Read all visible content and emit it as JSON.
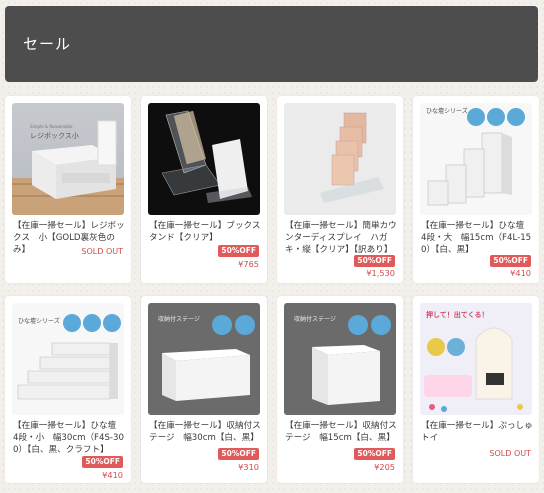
{
  "header": {
    "title": "セール"
  },
  "products": [
    {
      "name": "【在庫一掃セール】レジボックス　小【GOLD裏灰色のみ】",
      "status": "SOLD OUT",
      "thumb_text": "レジボックス小"
    },
    {
      "name": "【在庫一掃セール】ブックスタンド【クリア】",
      "badge": "50%OFF",
      "price": "¥765"
    },
    {
      "name": "【在庫一掃セール】簡単カウンターディスプレイ　ハガキ・縦【クリア】【訳あり】",
      "badge": "50%OFF",
      "price": "¥1,530"
    },
    {
      "name": "【在庫一掃セール】ひな壇　4段・大　幅15cm（F4L-150）【白、黒】",
      "badge": "50%OFF",
      "price": "¥410",
      "thumb_text": "ひな壇シリーズ"
    },
    {
      "name": "【在庫一掃セール】ひな壇　4段・小　幅30cm（F4S-300）【白、黒、クラフト】",
      "badge": "50%OFF",
      "price": "¥410",
      "thumb_text": "ひな壇シリーズ"
    },
    {
      "name": "【在庫一掃セール】収納付ステージ　幅30cm【白、黒】",
      "badge": "50%OFF",
      "price": "¥310",
      "thumb_text": "収納付ステージ"
    },
    {
      "name": "【在庫一掃セール】収納付ステージ　幅15cm【白、黒】",
      "badge": "50%OFF",
      "price": "¥205",
      "thumb_text": "収納付ステージ"
    },
    {
      "name": "【在庫一掃セール】ぷっしゅトイ",
      "status": "SOLD OUT",
      "thumb_text": "押して！出てくる！"
    }
  ],
  "colors": {
    "header_bg": "#4d4d4d",
    "badge_bg": "#e05a5a",
    "price_text": "#d44a4a",
    "card_bg": "#ffffff"
  },
  "icons": {
    "step_circles": "info-circle-icon"
  }
}
